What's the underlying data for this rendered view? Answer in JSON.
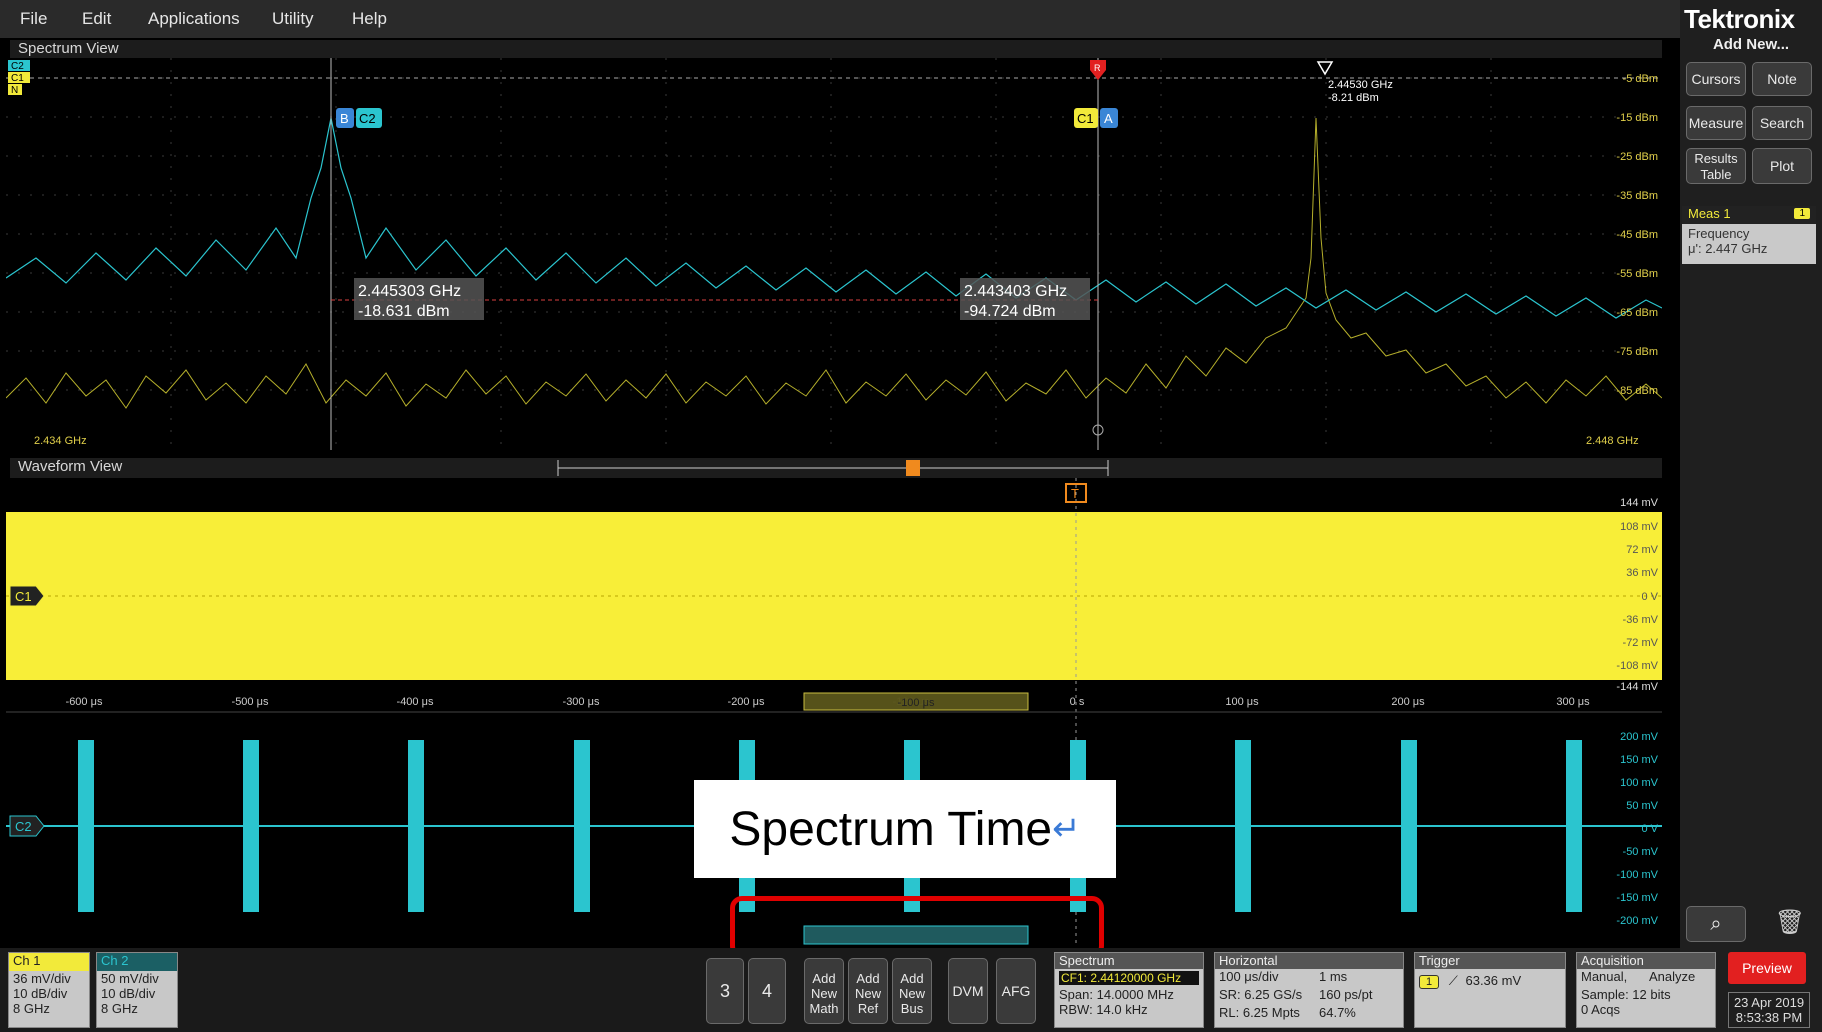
{
  "menu": {
    "file": "File",
    "edit": "Edit",
    "applications": "Applications",
    "utility": "Utility",
    "help": "Help"
  },
  "brand": "Tektronix",
  "sidebar": {
    "add_new": "Add New...",
    "cursors": "Cursors",
    "note": "Note",
    "measure": "Measure",
    "search": "Search",
    "results_table": "Results Table",
    "plot": "Plot"
  },
  "meas1": {
    "title": "Meas 1",
    "badge": "1",
    "name": "Frequency",
    "value": "μ': 2.447 GHz"
  },
  "spectrum": {
    "title": "Spectrum View",
    "left_freq": "2.434 GHz",
    "right_freq": "2.448 GHz",
    "y_ticks": [
      "-5 dBm",
      "-15 dBm",
      "-25 dBm",
      "-35 dBm",
      "-45 dBm",
      "-55 dBm",
      "-65 dBm",
      "-75 dBm",
      "-85 dBm"
    ],
    "cursor_b": {
      "label_b": "B",
      "label_c": "C2",
      "freq": "2.445303 GHz",
      "level": "-18.631 dBm"
    },
    "cursor_a": {
      "label_c": "C1",
      "label_a": "A",
      "freq": "2.443403 GHz",
      "level": "-94.724 dBm"
    },
    "peak": {
      "freq": "2.44530 GHz",
      "level": "-8.21 dBm"
    },
    "ref_marker": "R",
    "ch_labels": [
      "C2",
      "C1",
      "N"
    ]
  },
  "waveform": {
    "title": "Waveform View",
    "trigger_marker": "T",
    "c1_label": "C1",
    "c2_label": "C2",
    "c1_y_ticks": [
      "144 mV",
      "108 mV",
      "72 mV",
      "36 mV",
      "0 V",
      "-36 mV",
      "-72 mV",
      "-108 mV",
      "-144 mV"
    ],
    "c2_y_ticks": [
      "200 mV",
      "150 mV",
      "100 mV",
      "50 mV",
      "0 V",
      "-50 mV",
      "-100 mV",
      "-150 mV",
      "-200 mV"
    ],
    "x_ticks": [
      "-600 μs",
      "-500 μs",
      "-400 μs",
      "-300 μs",
      "-200 μs",
      "-100 μs",
      "0 s",
      "100 μs",
      "200 μs",
      "300 μs"
    ]
  },
  "overlay": {
    "text": "Spectrum Time",
    "return_symbol": "↵"
  },
  "bottom": {
    "ch1": {
      "title": "Ch 1",
      "line1": "36 mV/div",
      "line2": "10 dB/div",
      "line3": "8 GHz"
    },
    "ch2": {
      "title": "Ch 2",
      "line1": "50 mV/div",
      "line2": "10 dB/div",
      "line3": "8 GHz"
    },
    "btn3": "3",
    "btn4": "4",
    "add_math": "Add New Math",
    "add_ref": "Add New Ref",
    "add_bus": "Add New Bus",
    "dvm": "DVM",
    "afg": "AFG",
    "spectrum": {
      "title": "Spectrum",
      "cf": "CF1: 2.44120000 GHz",
      "span": "Span: 14.0000 MHz",
      "rbw": "RBW: 14.0 kHz"
    },
    "horizontal": {
      "title": "Horizontal",
      "a1": "100 μs/div",
      "a2": "1 ms",
      "b1": "SR: 6.25 GS/s",
      "b2": "160 ps/pt",
      "c1": "RL: 6.25 Mpts",
      "c2": "64.7%"
    },
    "trigger": {
      "title": "Trigger",
      "badge": "1",
      "value": "63.36 mV"
    },
    "acquisition": {
      "title": "Acquisition",
      "a1": "Manual,",
      "a2": "Analyze",
      "b1": "Sample: 12 bits",
      "c1": "0 Acqs"
    },
    "preview": "Preview",
    "date": "23 Apr 2019",
    "time": "8:53:38 PM"
  },
  "colors": {
    "ch1": "#f2ea3a",
    "ch2": "#2bc5cf",
    "accent_red": "#e22020"
  }
}
